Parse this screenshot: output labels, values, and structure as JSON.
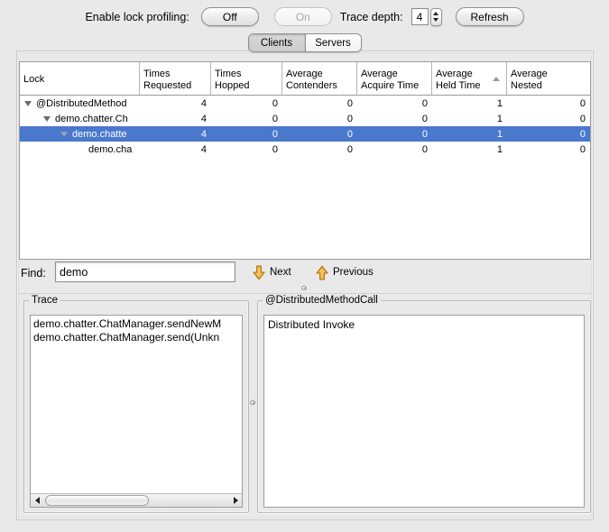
{
  "toolbar": {
    "enable_label": "Enable lock profiling:",
    "off_button": "Off",
    "on_button": "On",
    "trace_depth_label": "Trace depth:",
    "trace_depth_value": "4",
    "refresh_button": "Refresh"
  },
  "tabs": {
    "clients": "Clients",
    "servers": "Servers",
    "selected": "Clients"
  },
  "table": {
    "columns": [
      {
        "line1": "Lock",
        "line2": ""
      },
      {
        "line1": "Times",
        "line2": "Requested"
      },
      {
        "line1": "Times",
        "line2": "Hopped"
      },
      {
        "line1": "Average",
        "line2": "Contenders"
      },
      {
        "line1": "Average",
        "line2": "Acquire Time"
      },
      {
        "line1": "Average",
        "line2": "Held Time",
        "sorted": "ascending"
      },
      {
        "line1": "Average",
        "line2": "Nested"
      }
    ],
    "rows": [
      {
        "lock": "@DistributedMethod",
        "indent": 0,
        "expanded": true,
        "selected": false,
        "values": [
          4,
          0,
          0,
          0,
          1,
          0
        ]
      },
      {
        "lock": "demo.chatter.Ch",
        "indent": 1,
        "expanded": true,
        "selected": false,
        "values": [
          4,
          0,
          0,
          0,
          1,
          0
        ]
      },
      {
        "lock": "demo.chatte",
        "indent": 2,
        "expanded": true,
        "selected": true,
        "values": [
          4,
          0,
          0,
          0,
          1,
          0
        ]
      },
      {
        "lock": "demo.cha",
        "indent": 3,
        "expanded": false,
        "selected": false,
        "values": [
          4,
          0,
          0,
          0,
          1,
          0
        ]
      }
    ]
  },
  "find": {
    "label": "Find:",
    "value": "demo",
    "next_label": "Next",
    "previous_label": "Previous"
  },
  "trace_panel": {
    "title": "Trace",
    "items": [
      "demo.chatter.ChatManager.sendNewM",
      "demo.chatter.ChatManager.send(Unkn"
    ]
  },
  "detail_panel": {
    "title": "@DistributedMethodCall",
    "content": "Distributed Invoke"
  },
  "colors": {
    "selection_blue": "#4a78cd",
    "arrow_gold": "#f1a93b",
    "arrow_gold_border": "#ad7513",
    "background_gray": "#e9e9e9"
  }
}
